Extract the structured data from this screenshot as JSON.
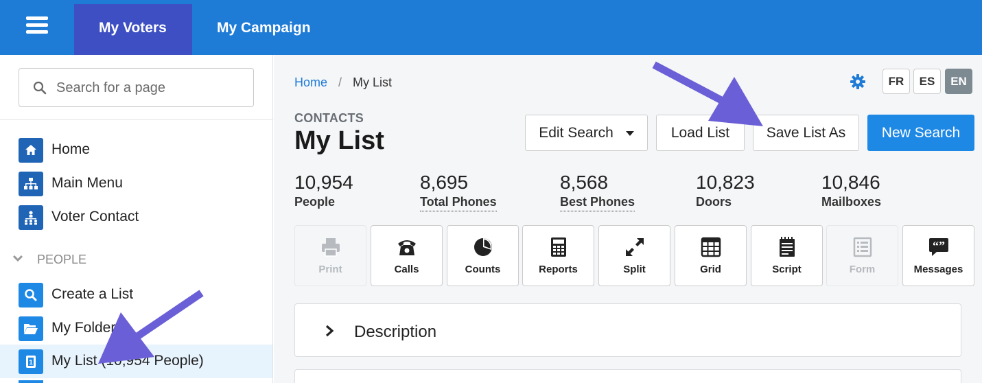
{
  "topbar": {
    "tabs": [
      {
        "label": "My Voters",
        "active": true
      },
      {
        "label": "My Campaign",
        "active": false
      }
    ]
  },
  "sidebar": {
    "search": {
      "placeholder": "Search for a page"
    },
    "items": [
      {
        "label": "Home",
        "icon": "home-icon"
      },
      {
        "label": "Main Menu",
        "icon": "sitemap-icon"
      },
      {
        "label": "Voter Contact",
        "icon": "people-hierarchy-icon"
      }
    ],
    "section": {
      "label": "PEOPLE"
    },
    "people_items": [
      {
        "label": "Create a List",
        "icon": "search-icon"
      },
      {
        "label": "My Folders",
        "icon": "folder-open-icon"
      },
      {
        "label": "My List (10,954 People)",
        "icon": "contact-book-icon",
        "active": true
      }
    ]
  },
  "breadcrumb": {
    "home": "Home",
    "separator": "/",
    "current": "My List"
  },
  "languages": [
    {
      "label": "FR",
      "active": false
    },
    {
      "label": "ES",
      "active": false
    },
    {
      "label": "EN",
      "active": true
    }
  ],
  "header": {
    "eyebrow": "CONTACTS",
    "title": "My List"
  },
  "actions": {
    "edit_search": "Edit Search",
    "load_list": "Load List",
    "save_list_as": "Save List As",
    "new_search": "New Search"
  },
  "stats": [
    {
      "value": "10,954",
      "label": "People"
    },
    {
      "value": "8,695",
      "label": "Total Phones"
    },
    {
      "value": "8,568",
      "label": "Best Phones"
    },
    {
      "value": "10,823",
      "label": "Doors"
    },
    {
      "value": "10,846",
      "label": "Mailboxes"
    }
  ],
  "tools": [
    {
      "label": "Print",
      "icon": "printer-icon",
      "enabled": false
    },
    {
      "label": "Calls",
      "icon": "telephone-icon",
      "enabled": true
    },
    {
      "label": "Counts",
      "icon": "pie-chart-icon",
      "enabled": true
    },
    {
      "label": "Reports",
      "icon": "calculator-icon",
      "enabled": true
    },
    {
      "label": "Split",
      "icon": "expand-arrows-icon",
      "enabled": true
    },
    {
      "label": "Grid",
      "icon": "grid-icon",
      "enabled": true
    },
    {
      "label": "Script",
      "icon": "script-notepad-icon",
      "enabled": true
    },
    {
      "label": "Form",
      "icon": "form-icon",
      "enabled": false
    },
    {
      "label": "Messages",
      "icon": "quote-bubble-icon",
      "enabled": true
    }
  ],
  "panels": [
    {
      "label": "Description"
    }
  ],
  "colors": {
    "topbar": "#1e7bd6",
    "active_tab": "#3d4fc2",
    "sidebar_icon_bg": "#1f64b5",
    "primary_button": "#1e88e5",
    "arrow": "#6a5fd6"
  }
}
